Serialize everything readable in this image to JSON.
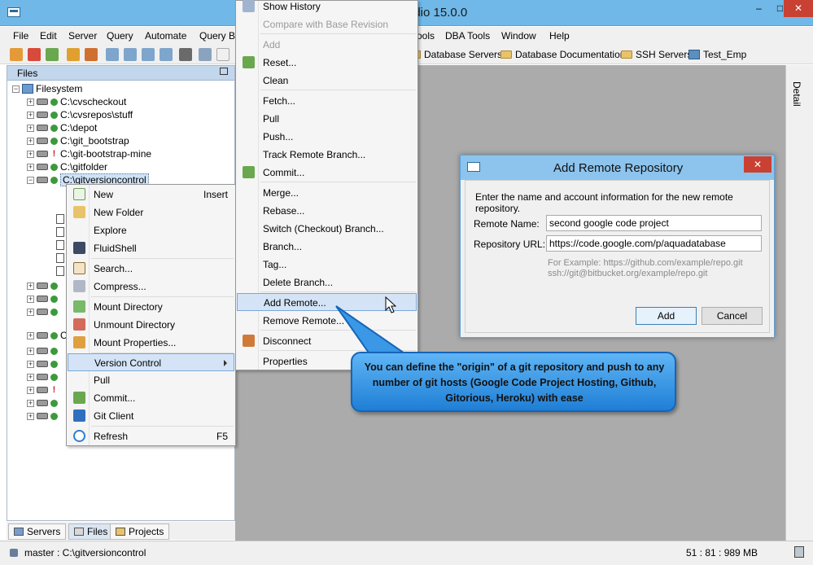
{
  "window": {
    "title": "udio 15.0.0",
    "controls": [
      "–",
      "□",
      "✕"
    ]
  },
  "menubar": {
    "items": [
      "File",
      "Edit",
      "Server",
      "Query",
      "Automate",
      "Query B",
      "ools",
      "DBA Tools",
      "Window",
      "Help"
    ]
  },
  "bookmarks": [
    "Database Servers",
    "Database Documentation",
    "SSH Servers",
    "Test_Emp"
  ],
  "files_panel": {
    "title": "Files",
    "root": "Filesystem",
    "rows": [
      {
        "label": "C:\\cvscheckout",
        "status": "ok"
      },
      {
        "label": "C:\\cvsrepos\\stuff",
        "status": "ok"
      },
      {
        "label": "C:\\depot",
        "status": "ok"
      },
      {
        "label": "C:\\git_bootstrap",
        "status": "ok"
      },
      {
        "label": "C:\\git-bootstrap-mine",
        "status": "warn"
      },
      {
        "label": "C:\\gitfolder",
        "status": "ok"
      },
      {
        "label": "C:\\gitversioncontrol",
        "status": "ok"
      }
    ],
    "partial_label": "C:"
  },
  "bottom_tabs": [
    "Servers",
    "Files",
    "Projects"
  ],
  "status": {
    "left": "master : C:\\gitversioncontrol",
    "right": "51 : 81 : 989 MB"
  },
  "detail_tab": "Detail",
  "left_menu": {
    "items": [
      {
        "label": "New",
        "shortcut": "Insert"
      },
      {
        "label": "New Folder"
      },
      {
        "label": "Explore"
      },
      {
        "label": "FluidShell"
      },
      {
        "label": "Search..."
      },
      {
        "label": "Compress..."
      },
      {
        "label": "Mount Directory"
      },
      {
        "label": "Unmount Directory"
      },
      {
        "label": "Mount Properties..."
      },
      {
        "label": "Version Control"
      },
      {
        "label": "Pull"
      },
      {
        "label": "Commit..."
      },
      {
        "label": "Git Client"
      },
      {
        "label": "Refresh",
        "shortcut": "F5"
      }
    ]
  },
  "vc_menu": {
    "items": [
      {
        "label": "Show History"
      },
      {
        "label": "Compare with Base Revision"
      },
      {
        "label": "Add"
      },
      {
        "label": "Reset..."
      },
      {
        "label": "Clean"
      },
      {
        "label": "Fetch..."
      },
      {
        "label": "Pull"
      },
      {
        "label": "Push..."
      },
      {
        "label": "Track Remote Branch..."
      },
      {
        "label": "Commit..."
      },
      {
        "label": "Merge..."
      },
      {
        "label": "Rebase..."
      },
      {
        "label": "Switch (Checkout) Branch..."
      },
      {
        "label": "Branch..."
      },
      {
        "label": "Tag..."
      },
      {
        "label": "Delete Branch..."
      },
      {
        "label": "Add Remote..."
      },
      {
        "label": "Remove Remote..."
      },
      {
        "label": "Disconnect"
      },
      {
        "label": "Properties"
      }
    ]
  },
  "dialog": {
    "title": "Add Remote Repository",
    "description": "Enter the name and account information for the new remote repository.",
    "remote_name_label": "Remote Name:",
    "remote_name_value": "second google code project",
    "repo_url_label": "Repository URL:",
    "repo_url_value": "https://code.google.com/p/aquadatabase",
    "hint_line1": "For Example: https://github.com/example/repo.git",
    "hint_line2": "ssh://git@bitbucket.org/example/repo.git",
    "add_label": "Add",
    "cancel_label": "Cancel",
    "close_glyph": "✕"
  },
  "callout": {
    "text": "You can define the \"origin\" of a git repository and push to any number of git hosts (Google Code Project Hosting, Github, Gitorious, Heroku)  with ease"
  },
  "colors": {
    "titlebar": "#6fb8e8",
    "close": "#c94133",
    "callout": "#1f7fd6",
    "highlight": "#d4e4f6"
  }
}
